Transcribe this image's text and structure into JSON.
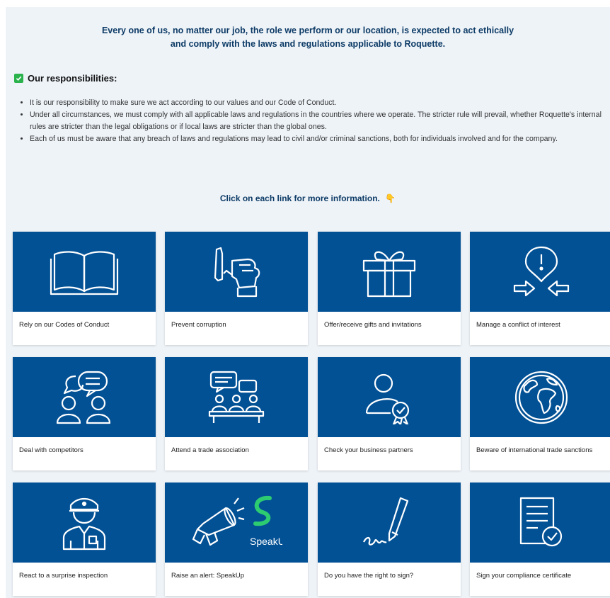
{
  "intro": {
    "line1": "Every one of us, no matter our job, the role we perform or our location, is expected to act ethically",
    "line2": "and comply with the laws and regulations applicable to Roquette."
  },
  "responsibilities": {
    "heading": "Our responsibilities:",
    "items": [
      "It is our responsibility to make sure we act according to our values and our Code of Conduct.",
      "Under all circumstances, we must comply with all applicable laws and regulations in the countries where we operate. The stricter rule will prevail, whether Roquette's internal rules are stricter than the legal obligations or if local laws are stricter than the global ones.",
      "Each of us must be aware that any breach of laws and regulations may lead to civil and/or criminal sanctions, both for individuals involved and for the company."
    ]
  },
  "click_info": "Click on each link for more information.",
  "pointing_emoji": "👇",
  "cards": [
    {
      "label": "Rely on our Codes of Conduct",
      "icon": "open-book-icon"
    },
    {
      "label": "Prevent corruption",
      "icon": "refuse-hand-icon"
    },
    {
      "label": "Offer/receive gifts and invitations",
      "icon": "gift-icon"
    },
    {
      "label": "Manage a conflict of interest",
      "icon": "conflict-arrows-icon"
    },
    {
      "label": "Deal with competitors",
      "icon": "two-people-chat-icon"
    },
    {
      "label": "Attend a trade association",
      "icon": "meeting-group-icon"
    },
    {
      "label": "Check your business partners",
      "icon": "verified-person-icon"
    },
    {
      "label": "Beware of international trade sanctions",
      "icon": "globe-icon"
    },
    {
      "label": "React to a surprise inspection",
      "icon": "police-officer-icon"
    },
    {
      "label": "Raise an alert: SpeakUp",
      "icon": "megaphone-speakup-icon"
    },
    {
      "label": "Do you have the right to sign?",
      "icon": "signature-pen-icon"
    },
    {
      "label": "Sign your compliance certificate",
      "icon": "certificate-icon"
    }
  ],
  "speakup_logo_text": "SpeakUp",
  "colors": {
    "card_blue": "#035195",
    "heading_navy": "#0d3b66",
    "check_green": "#2bb24c",
    "speakup_green": "#2ecc71"
  }
}
